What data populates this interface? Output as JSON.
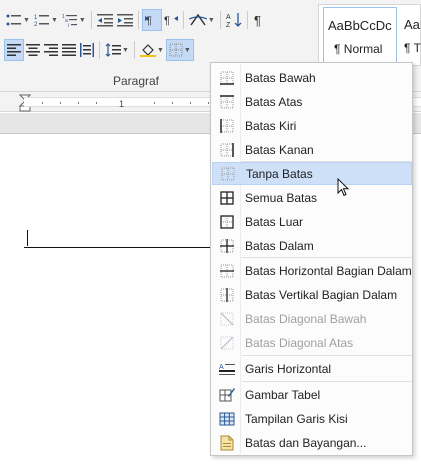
{
  "ribbon": {
    "group_label": "Paragraf",
    "row1_icons": [
      "bullets-icon",
      "numbering-icon",
      "multilevel-list-icon",
      "decrease-indent-icon",
      "increase-indent-icon",
      "ltr-icon",
      "rtl-icon",
      "text-effects-icon",
      "sort-icon",
      "pilcrow-icon"
    ],
    "row2_icons": [
      "align-left-icon",
      "align-center-icon",
      "align-right-icon",
      "justify-icon",
      "distributed-icon",
      "line-spacing-icon",
      "shading-icon",
      "borders-icon"
    ],
    "styles": [
      {
        "sample": "AaBbCcDc",
        "name": "¶ Normal"
      },
      {
        "sample": "AaBbCcDc",
        "name": "¶ T"
      }
    ]
  },
  "ruler": {
    "number": "1"
  },
  "menu": {
    "items": [
      {
        "label": "Batas Bawah",
        "icon": "border-bottom-icon",
        "state": "normal"
      },
      {
        "label": "Batas Atas",
        "icon": "border-top-icon",
        "state": "normal"
      },
      {
        "label": "Batas Kiri",
        "icon": "border-left-icon",
        "state": "normal"
      },
      {
        "label": "Batas Kanan",
        "icon": "border-right-icon",
        "state": "normal"
      },
      {
        "label": "Tanpa Batas",
        "icon": "no-border-icon",
        "state": "hover"
      },
      {
        "label": "Semua Batas",
        "icon": "all-borders-icon",
        "state": "normal"
      },
      {
        "label": "Batas Luar",
        "icon": "outside-borders-icon",
        "state": "normal"
      },
      {
        "label": "Batas Dalam",
        "icon": "inside-borders-icon",
        "state": "normal"
      },
      {
        "label": "Batas Horizontal Bagian Dalam",
        "icon": "inside-horizontal-border-icon",
        "state": "normal"
      },
      {
        "label": "Batas Vertikal Bagian Dalam",
        "icon": "inside-vertical-border-icon",
        "state": "normal"
      },
      {
        "label": "Batas Diagonal Bawah",
        "icon": "diagonal-down-border-icon",
        "state": "disabled"
      },
      {
        "label": "Batas Diagonal Atas",
        "icon": "diagonal-up-border-icon",
        "state": "disabled"
      },
      {
        "label": "Garis Horizontal",
        "icon": "horizontal-line-icon",
        "state": "normal"
      },
      {
        "label": "Gambar Tabel",
        "icon": "draw-table-icon",
        "state": "normal"
      },
      {
        "label": "Tampilan Garis Kisi",
        "icon": "view-gridlines-icon",
        "state": "normal"
      },
      {
        "label": "Batas dan Bayangan...",
        "icon": "borders-shading-icon",
        "state": "normal"
      }
    ]
  }
}
